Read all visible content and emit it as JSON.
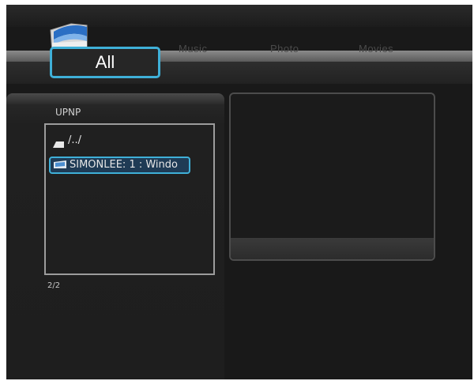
{
  "tabs": [
    {
      "label": "All",
      "active": true
    },
    {
      "label": "Music",
      "active": false
    },
    {
      "label": "Photo",
      "active": false
    },
    {
      "label": "Movies",
      "active": false
    }
  ],
  "browser": {
    "source": "UPNP",
    "items": [
      {
        "label": "/../",
        "icon": "folder-up-icon",
        "selected": false
      },
      {
        "label": "SIMONLEE: 1 : Windo",
        "icon": "network-share-icon",
        "selected": true
      }
    ],
    "page_indicator": "2/2"
  },
  "colors": {
    "accent": "#3fb0d8",
    "background": "#191919",
    "panel_border": "#9c9c9c"
  }
}
